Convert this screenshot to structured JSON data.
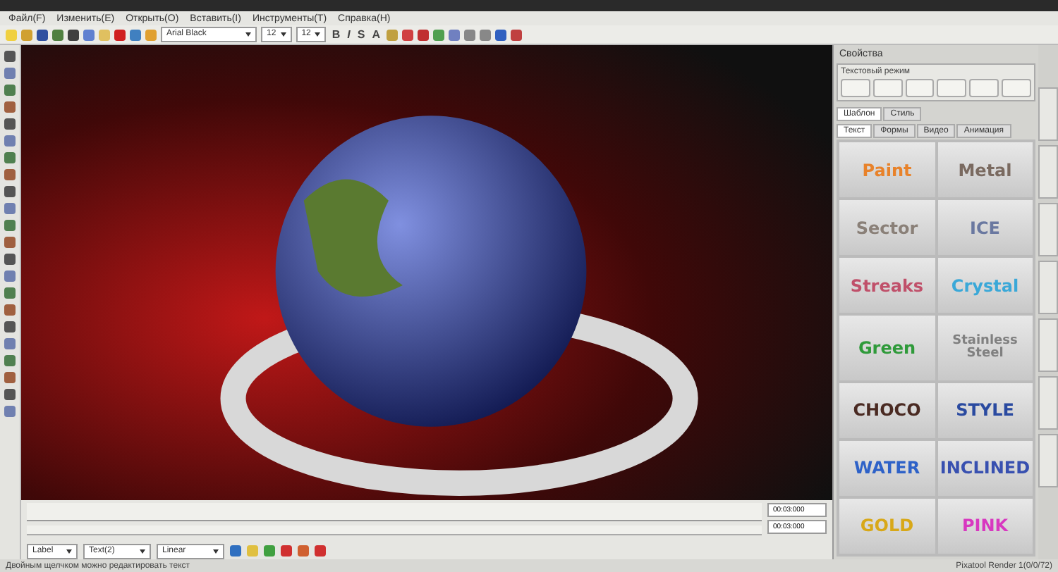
{
  "menu": [
    "Файл(F)",
    "Изменить(E)",
    "Открыть(O)",
    "Вставить(I)",
    "Инструменты(T)",
    "Справка(H)"
  ],
  "toolbar": {
    "font": "Arial Black",
    "size": "12",
    "size_2": "12",
    "format_buttons": [
      "B",
      "I",
      "S",
      "A"
    ]
  },
  "properties": {
    "title": "Свойства",
    "mode_label": "Текстовый режим",
    "tabs": [
      {
        "label": "Шаблон",
        "selected": true
      },
      {
        "label": "Стиль",
        "selected": false
      }
    ],
    "subtabs": [
      {
        "label": "Текст",
        "selected": true
      },
      {
        "label": "Формы",
        "selected": false
      },
      {
        "label": "Видео",
        "selected": false
      },
      {
        "label": "Анимация",
        "selected": false
      }
    ],
    "styles": [
      {
        "label": "Paint",
        "color": "#e8822a"
      },
      {
        "label": "Metal",
        "color": "#7a6a60"
      },
      {
        "label": "Sector",
        "color": "#8a8078"
      },
      {
        "label": "ICE",
        "color": "#6a78a0"
      },
      {
        "label": "Streaks",
        "color": "#c0506a"
      },
      {
        "label": "Crystal",
        "color": "#3aa8d8"
      },
      {
        "label": "Green",
        "color": "#2f9a3a"
      },
      {
        "label": "Stainless Steel",
        "color": "#808080"
      },
      {
        "label": "CHOCO",
        "color": "#4a2a22"
      },
      {
        "label": "STYLE",
        "color": "#2a4aa0"
      },
      {
        "label": "WATER",
        "color": "#2e62c8"
      },
      {
        "label": "INCLINED",
        "color": "#3850b0"
      },
      {
        "label": "GOLD",
        "color": "#d8a818"
      },
      {
        "label": "PINK",
        "color": "#d838c0"
      }
    ]
  },
  "timeline": {
    "times": [
      "00:03:000",
      "00:03:000"
    ],
    "layer": "Label",
    "object": "Text(2)",
    "interpolation": "Linear"
  },
  "status": {
    "hint": "Двойным щелчком можно редактировать текст",
    "version": "Pixatool Render 1(0/0/72)"
  }
}
